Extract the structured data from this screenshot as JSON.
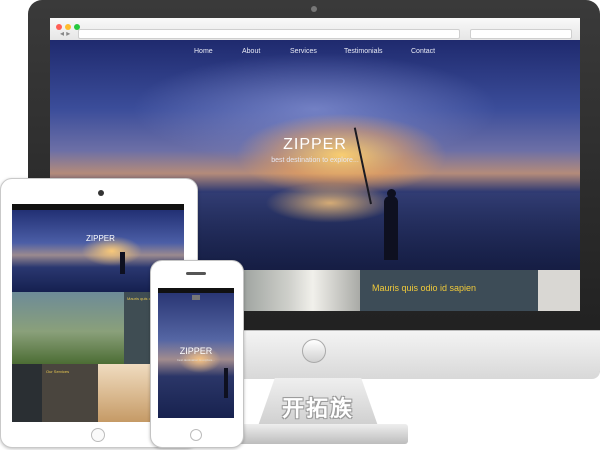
{
  "desktop": {
    "nav": [
      "Home",
      "About",
      "Services",
      "Testimonials",
      "Contact"
    ],
    "hero_title": "ZIPPER",
    "hero_subtitle": "best destination to explore...",
    "strip_heading": "Mauris quis odio id sapien"
  },
  "tablet": {
    "hero_title": "ZIPPER",
    "side_heading": "Mauris quis odio id",
    "services_heading": "Our Services"
  },
  "phone": {
    "hero_title": "ZIPPER",
    "hero_subtitle": "best destination to explore..."
  },
  "brand": {
    "text": "开拓族"
  },
  "colors": {
    "accent_yellow": "#f1ca3a",
    "browser_dot_red": "#ff5f56",
    "browser_dot_yellow": "#ffbd2e",
    "browser_dot_green": "#27c93f"
  }
}
